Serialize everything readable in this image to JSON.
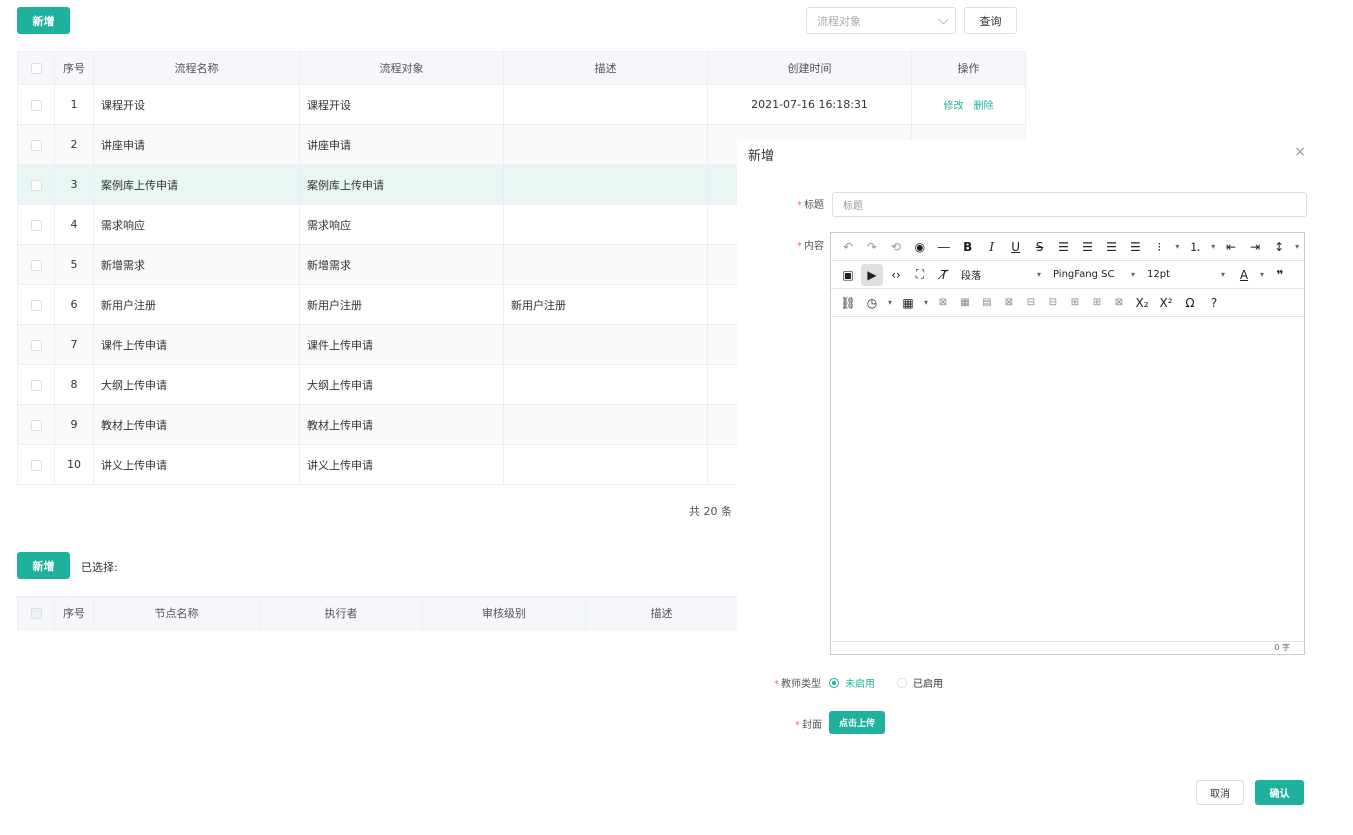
{
  "toolbar": {
    "add_label": "新增",
    "select_placeholder": "流程对象",
    "query_label": "查询"
  },
  "flow_table": {
    "columns": [
      "序号",
      "流程名称",
      "流程对象",
      "描述",
      "创建时间",
      "操作"
    ],
    "rows": [
      {
        "no": "1",
        "name": "课程开设",
        "target": "课程开设",
        "desc": "",
        "time": "2021-07-16 16:18:31",
        "edit": "修改",
        "delete": "删除"
      },
      {
        "no": "2",
        "name": "讲座申请",
        "target": "讲座申请",
        "desc": "",
        "time": "",
        "edit": "",
        "delete": ""
      },
      {
        "no": "3",
        "name": "案例库上传申请",
        "target": "案例库上传申请",
        "desc": "",
        "time": "",
        "edit": "",
        "delete": ""
      },
      {
        "no": "4",
        "name": "需求响应",
        "target": "需求响应",
        "desc": "",
        "time": "",
        "edit": "",
        "delete": ""
      },
      {
        "no": "5",
        "name": "新增需求",
        "target": "新增需求",
        "desc": "",
        "time": "",
        "edit": "",
        "delete": ""
      },
      {
        "no": "6",
        "name": "新用户注册",
        "target": "新用户注册",
        "desc": "新用户注册",
        "time": "",
        "edit": "",
        "delete": ""
      },
      {
        "no": "7",
        "name": "课件上传申请",
        "target": "课件上传申请",
        "desc": "",
        "time": "",
        "edit": "",
        "delete": ""
      },
      {
        "no": "8",
        "name": "大纲上传申请",
        "target": "大纲上传申请",
        "desc": "",
        "time": "",
        "edit": "",
        "delete": ""
      },
      {
        "no": "9",
        "name": "教材上传申请",
        "target": "教材上传申请",
        "desc": "",
        "time": "",
        "edit": "",
        "delete": ""
      },
      {
        "no": "10",
        "name": "讲义上传申请",
        "target": "讲义上传申请",
        "desc": "",
        "time": "",
        "edit": "",
        "delete": ""
      }
    ],
    "total": "共 20 条"
  },
  "node_section": {
    "add_label": "新增",
    "selected_label": "已选择:",
    "columns": [
      "序号",
      "节点名称",
      "执行者",
      "审核级别",
      "描述"
    ]
  },
  "dialog": {
    "title": "新增",
    "close": "×",
    "title_label": "标题",
    "title_placeholder": "标题",
    "content_label": "内容",
    "editor": {
      "block_format": "段落",
      "font_family": "PingFang SC",
      "font_size": "12pt",
      "word_count": "0 字"
    },
    "teacher_type_label": "教师类型",
    "radio_options": [
      "未启用",
      "已启用"
    ],
    "cover_label": "封面",
    "upload_label": "点击上传",
    "cancel_label": "取消",
    "confirm_label": "确认"
  },
  "colors": {
    "primary": "#1fb19e",
    "required": "#f56c6c"
  }
}
